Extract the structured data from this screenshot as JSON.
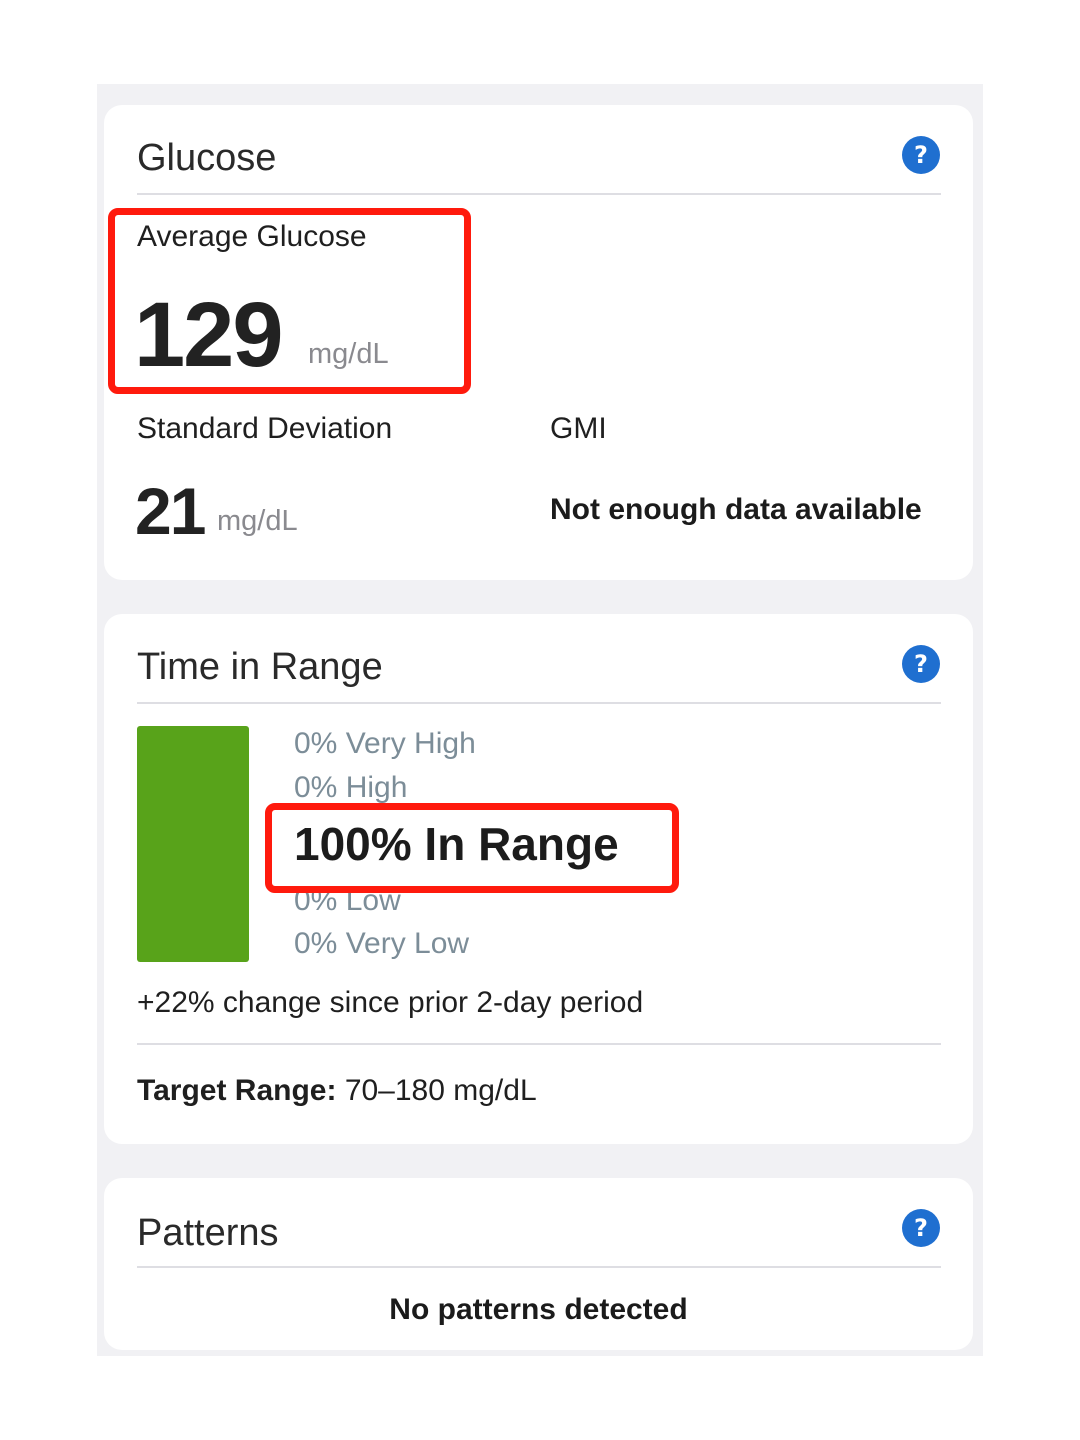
{
  "glucose": {
    "title": "Glucose",
    "help": "?",
    "average_label": "Average Glucose",
    "average_value": "129",
    "average_unit": "mg/dL",
    "sd_label": "Standard Deviation",
    "sd_value": "21",
    "sd_unit": "mg/dL",
    "gmi_label": "GMI",
    "gmi_value": "Not enough data available"
  },
  "time_in_range": {
    "title": "Time in Range",
    "help": "?",
    "very_high": "0% Very High",
    "high": "0% High",
    "in_range": "100% In Range",
    "low": "0% Low",
    "very_low": "0% Very Low",
    "in_range_fraction": 1.0,
    "bar_color": "#58a31a",
    "change": "+22% change since prior 2-day period",
    "target_label": "Target Range:",
    "target_value": "70–180 mg/dL"
  },
  "patterns": {
    "title": "Patterns",
    "help": "?",
    "message": "No patterns detected"
  },
  "colors": {
    "accent": "#1f6fd0",
    "highlight": "#ff1a0d"
  }
}
